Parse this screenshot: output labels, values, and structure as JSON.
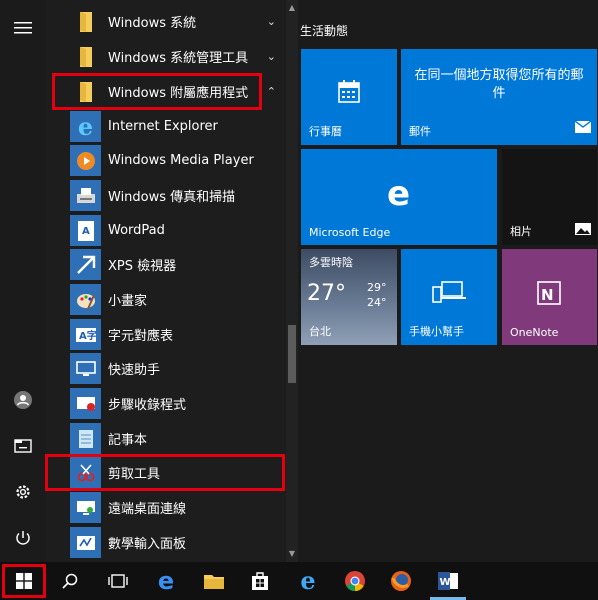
{
  "start_menu": {
    "apps": [
      {
        "label": "Windows 系統",
        "chevron": "⌄",
        "icon": "folder-icon"
      },
      {
        "label": "Windows 系統管理工具",
        "chevron": "⌄",
        "icon": "folder-icon"
      },
      {
        "label": "Windows 附屬應用程式",
        "chevron": "⌃",
        "icon": "folder-icon"
      },
      {
        "label": "Internet Explorer",
        "icon": "internet-explorer-icon"
      },
      {
        "label": "Windows Media Player",
        "icon": "media-player-icon"
      },
      {
        "label": "Windows 傳真和掃描",
        "icon": "fax-scan-icon"
      },
      {
        "label": "WordPad",
        "icon": "wordpad-icon"
      },
      {
        "label": "XPS 檢視器",
        "icon": "xps-viewer-icon"
      },
      {
        "label": "小畫家",
        "icon": "paint-icon"
      },
      {
        "label": "字元對應表",
        "icon": "character-map-icon"
      },
      {
        "label": "快速助手",
        "icon": "quick-assist-icon"
      },
      {
        "label": "步驟收錄程式",
        "icon": "steps-recorder-icon"
      },
      {
        "label": "記事本",
        "icon": "notepad-icon"
      },
      {
        "label": "剪取工具",
        "icon": "snipping-tool-icon"
      },
      {
        "label": "遠端桌面連線",
        "icon": "remote-desktop-icon"
      },
      {
        "label": "數學輸入面板",
        "icon": "math-input-icon"
      }
    ],
    "tiles_group_label": "生活動態",
    "tiles": {
      "calendar": {
        "label": "行事曆"
      },
      "mail": {
        "label": "郵件",
        "text": "在同一個地方取得您所有的郵件"
      },
      "edge": {
        "label": "Microsoft Edge"
      },
      "photos": {
        "label": "相片"
      },
      "weather": {
        "label": "多雲時陰",
        "temp": "27°",
        "high": "29°",
        "low": "24°",
        "city": "台北"
      },
      "phone": {
        "label": "手機小幫手"
      },
      "onenote": {
        "label": "OneNote"
      }
    }
  },
  "colors": {
    "accent": "#0078d7",
    "onenote": "#80397b",
    "highlight": "#e3000f"
  }
}
